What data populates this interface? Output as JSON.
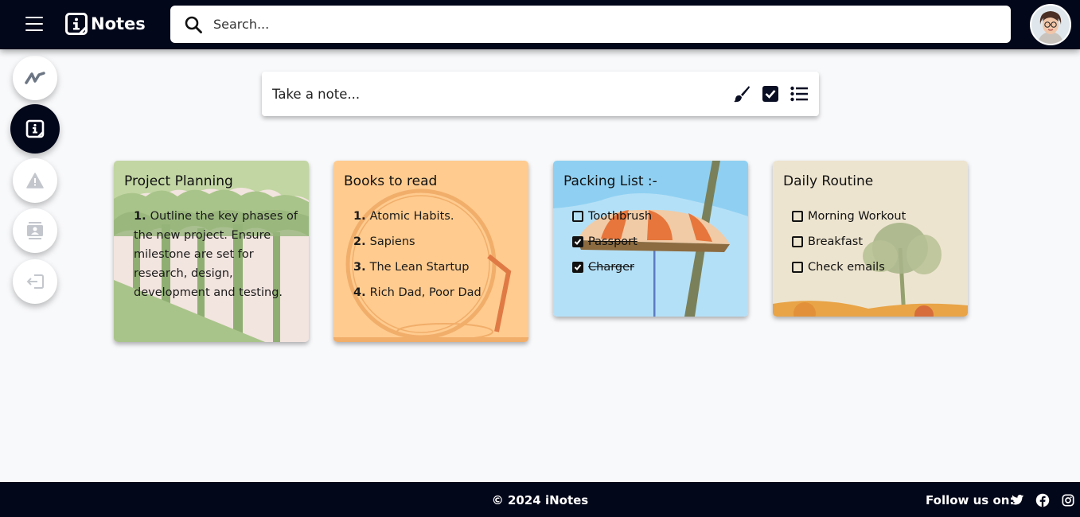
{
  "app": {
    "title": "Notes"
  },
  "search": {
    "placeholder": "Search..."
  },
  "composer": {
    "placeholder": "Take a note..."
  },
  "notes": [
    {
      "title": "Project Planning",
      "type": "list",
      "items": [
        "Outline the key phases of",
        "the new project. Ensure",
        "milestone are set for",
        "research, design,",
        "development and testing."
      ]
    },
    {
      "title": "Books to read",
      "type": "ordered",
      "items": [
        {
          "num": "1.",
          "text": "Atomic Habits."
        },
        {
          "num": "2.",
          "text": "Sapiens"
        },
        {
          "num": "3.",
          "text": "The Lean Startup"
        },
        {
          "num": "4.",
          "text": "Rich Dad, Poor Dad"
        }
      ]
    },
    {
      "title": "Packing List :-",
      "type": "checklist",
      "items": [
        {
          "text": "Toothbrush",
          "checked": false
        },
        {
          "text": "Passport",
          "checked": true
        },
        {
          "text": "Charger",
          "checked": true
        }
      ]
    },
    {
      "title": "Daily Routine",
      "type": "checklist",
      "items": [
        {
          "text": "Morning Workout",
          "checked": false
        },
        {
          "text": "Breakfast",
          "checked": false
        },
        {
          "text": "Check emails",
          "checked": false
        }
      ]
    }
  ],
  "footer": {
    "copyright": "© 2024 iNotes",
    "follow": "Follow us on:"
  },
  "colors": {
    "header": "#03071a",
    "card_project": "#c5d8a4",
    "card_books": "#ffcb8f",
    "card_packing": "#b4e0f7",
    "card_routine": "#ede4cf"
  }
}
